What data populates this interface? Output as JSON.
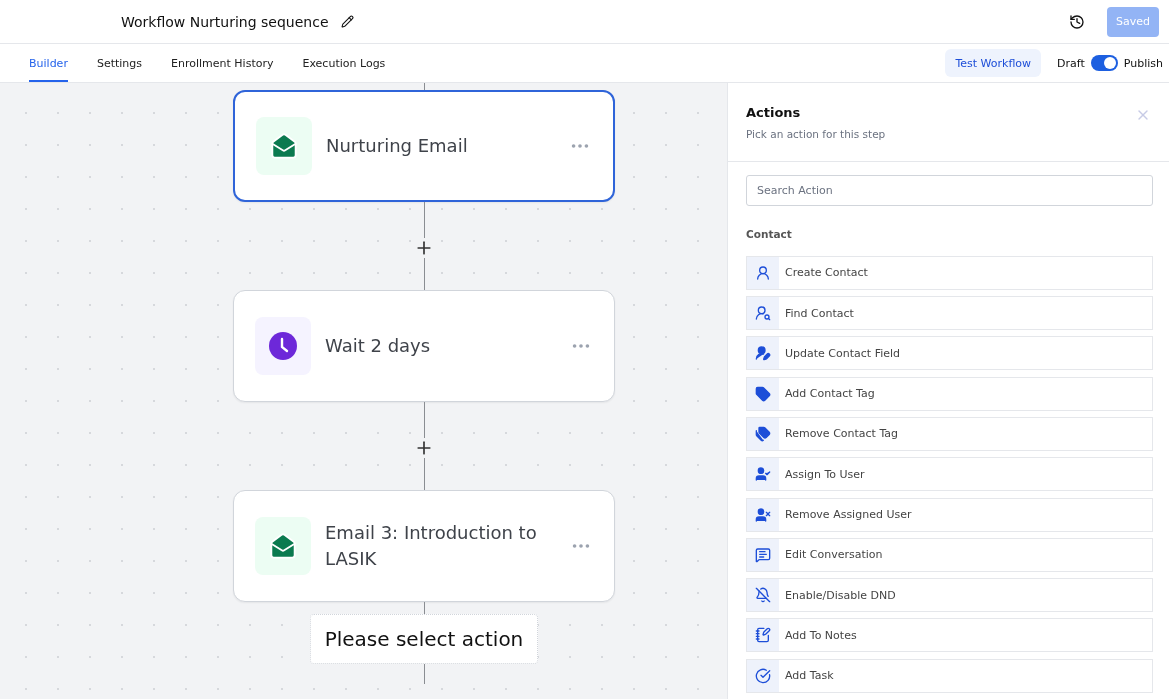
{
  "header": {
    "title": "Workflow Nurturing sequence",
    "save_button": {
      "label": "Saved",
      "disabled": true
    }
  },
  "tabs": [
    {
      "label": "Builder",
      "selected": true
    },
    {
      "label": "Settings",
      "selected": false
    },
    {
      "label": "Enrollment History",
      "selected": false
    },
    {
      "label": "Execution Logs",
      "selected": false
    }
  ],
  "test_button": "Test Workflow",
  "publish_toggle": {
    "off_label": "Draft",
    "on_label": "Publish",
    "on": true
  },
  "canvas": {
    "nodes": [
      {
        "kind": "email",
        "title": "Nurturing Email",
        "selected": true
      },
      {
        "kind": "wait",
        "title": "Wait 2 days",
        "selected": false
      },
      {
        "kind": "email",
        "title": "Email 3: Introduction to LASIK",
        "selected": false
      }
    ],
    "placeholder_node": "Please select action"
  },
  "actions_panel": {
    "title": "Actions",
    "subtitle": "Pick an action for this step",
    "search": {
      "placeholder": "Search Action"
    },
    "section": "Contact",
    "items": [
      {
        "kind": "create",
        "label": "Create Contact"
      },
      {
        "kind": "find",
        "label": "Find Contact"
      },
      {
        "kind": "update",
        "label": "Update Contact Field"
      },
      {
        "kind": "tag",
        "label": "Add Contact Tag"
      },
      {
        "kind": "untag",
        "label": "Remove Contact Tag"
      },
      {
        "kind": "assign",
        "label": "Assign To User"
      },
      {
        "kind": "unassign",
        "label": "Remove Assigned User"
      },
      {
        "kind": "conversation",
        "label": "Edit Conversation"
      },
      {
        "kind": "dnd",
        "label": "Enable/Disable DND"
      },
      {
        "kind": "notes",
        "label": "Add To Notes"
      },
      {
        "kind": "task",
        "label": "Add Task"
      }
    ]
  }
}
